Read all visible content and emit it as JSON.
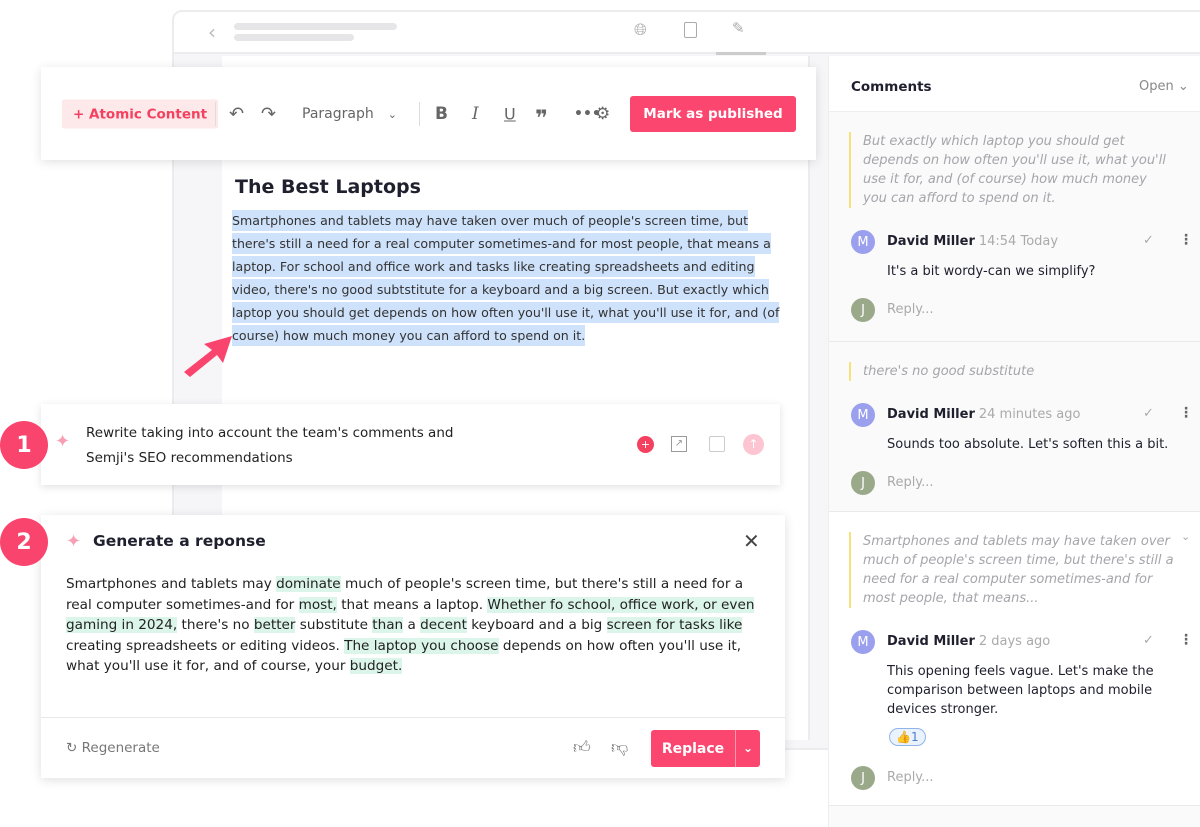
{
  "toolbar": {
    "atomic": "+ Atomic Content",
    "paragraph": "Paragraph",
    "publish": "Mark as published"
  },
  "doc": {
    "title": "The Best Laptops",
    "body": "Smartphones and tablets may have taken over much of people's screen time, but there's still a need for a real computer sometimes-and for most people, that means a laptop. For school and office work and tasks like creating spreadsheets and editing video, there's no good subtstitute for a keyboard and a big screen. But exactly which laptop you should get depends on how often you'll use it, what you'll use it for, and (of course) how much money you can afford to spend on it."
  },
  "steps": [
    "1",
    "2"
  ],
  "prompt": {
    "line1": "Rewrite taking into account the team's comments and",
    "line2": "Semji's SEO recommendations"
  },
  "response": {
    "title": "Generate a reponse",
    "regenerate": "Regenerate",
    "replace": "Replace",
    "segments": [
      {
        "t": "Smartphones and tablets may ",
        "h": false
      },
      {
        "t": "dominate",
        "h": true
      },
      {
        "t": " much of people's screen time, but there's still a need for a real computer sometimes-and for ",
        "h": false
      },
      {
        "t": "most,",
        "h": true
      },
      {
        "t": " that means a laptop. ",
        "h": false
      },
      {
        "t": "Whether fo school, office work, or even gaming in 2024,",
        "h": true
      },
      {
        "t": " there's no ",
        "h": false
      },
      {
        "t": "better",
        "h": true
      },
      {
        "t": " substitute ",
        "h": false
      },
      {
        "t": "than",
        "h": true
      },
      {
        "t": " a ",
        "h": false
      },
      {
        "t": "decent",
        "h": true
      },
      {
        "t": " keyboard and a big ",
        "h": false
      },
      {
        "t": "screen for tasks like",
        "h": true
      },
      {
        "t": " creating spreadsheets or editing videos. ",
        "h": false
      },
      {
        "t": "The laptop you choose",
        "h": true
      },
      {
        "t": " depends on how often you'll use it, what you'll use it for, and of course, your ",
        "h": false
      },
      {
        "t": "budget.",
        "h": true
      }
    ]
  },
  "comments": {
    "title": "Comments",
    "filter": "Open",
    "reply_placeholder": "Reply...",
    "threads": [
      {
        "quote": "But exactly which laptop you should get depends on how often you'll use it, what you'll use it for, and (of course) how much money you can afford to spend on it.",
        "author": "David Miller",
        "initial": "M",
        "time": "14:54 Today",
        "text": "It's a bit wordy-can we simplify?"
      },
      {
        "quote": "there's no good substitute",
        "author": "David Miller",
        "initial": "M",
        "time": "24 minutes ago",
        "text": "Sounds too absolute. Let's soften this a bit."
      },
      {
        "quote": "Smartphones and tablets may have taken over much of people's screen time, but there's still a need for a real computer sometimes-and for most people, that means...",
        "author": "David Miller",
        "initial": "M",
        "time": "2 days ago",
        "text": "This opening feels vague. Let's make the comparison between laptops and mobile devices stronger.",
        "reaction": "👍",
        "reaction_count": "1"
      }
    ],
    "reply_initial": "J"
  },
  "colors": {
    "accent": "#fb4770",
    "highlight_selection": "#cfe2fb",
    "highlight_change": "#dcf5ea",
    "avatar_m": "#9a9fee",
    "avatar_j": "#9aa98a"
  }
}
